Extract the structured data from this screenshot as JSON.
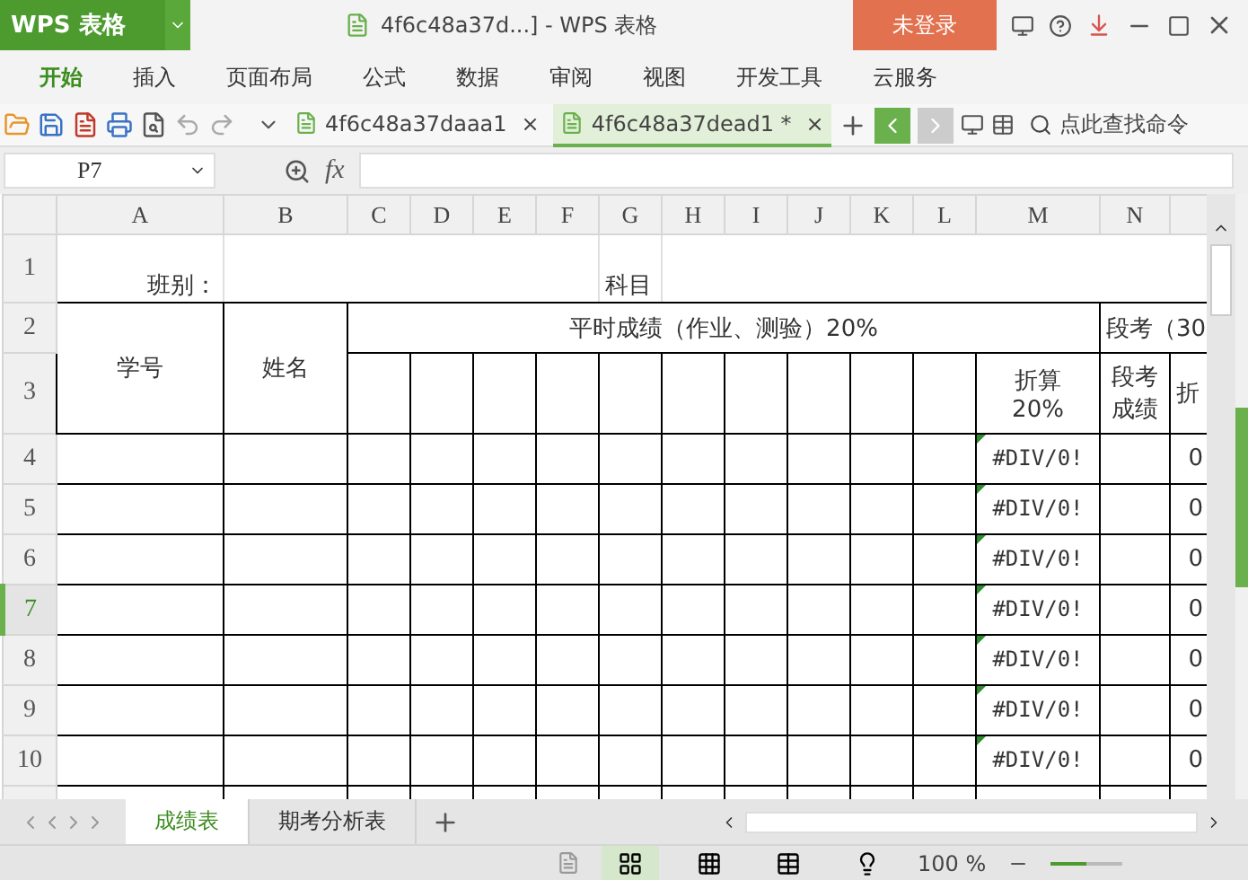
{
  "app": {
    "logo": "WPS 表格",
    "title": "4f6c48a37d...] - WPS 表格",
    "login": "未登录"
  },
  "menu": [
    {
      "label": "开始",
      "selected": true
    },
    {
      "label": "插入",
      "selected": false
    },
    {
      "label": "页面布局",
      "selected": false
    },
    {
      "label": "公式",
      "selected": false
    },
    {
      "label": "数据",
      "selected": false
    },
    {
      "label": "审阅",
      "selected": false
    },
    {
      "label": "视图",
      "selected": false
    },
    {
      "label": "开发工具",
      "selected": false
    },
    {
      "label": "云服务",
      "selected": false
    }
  ],
  "doc_tabs": [
    {
      "label": "4f6c48a37daaa1",
      "close": "×",
      "selected": false
    },
    {
      "label": "4f6c48a37dead1 *",
      "close": "×",
      "selected": true
    }
  ],
  "search": {
    "placeholder": "点此查找命令"
  },
  "formula_bar": {
    "cell": "P7",
    "fx": "fx"
  },
  "sheet": {
    "columns": [
      "A",
      "B",
      "C",
      "D",
      "E",
      "F",
      "G",
      "H",
      "I",
      "J",
      "K",
      "L",
      "M",
      "N"
    ],
    "row_headers": [
      {
        "label": "1",
        "selected": false
      },
      {
        "label": "2",
        "selected": false
      },
      {
        "label": "3",
        "selected": false
      },
      {
        "label": "4",
        "selected": false
      },
      {
        "label": "5",
        "selected": false
      },
      {
        "label": "6",
        "selected": false
      },
      {
        "label": "7",
        "selected": true
      },
      {
        "label": "8",
        "selected": false
      },
      {
        "label": "9",
        "selected": false
      },
      {
        "label": "10",
        "selected": false
      }
    ],
    "class_label": "班别：",
    "subject_label": "科目",
    "student_id": "学号",
    "name": "姓名",
    "regular_scores": "平时成绩（作业、测验）20%",
    "regular_weighted": [
      "折算",
      "20%"
    ],
    "exam": "段考（30",
    "exam_score": [
      "段考",
      "成绩"
    ],
    "exam_weighted": "折",
    "data_rows": [
      {
        "column_m": "#DIV/0!",
        "column_o": "0"
      },
      {
        "column_m": "#DIV/0!",
        "column_o": "0"
      },
      {
        "column_m": "#DIV/0!",
        "column_o": "0"
      },
      {
        "column_m": "#DIV/0!",
        "column_o": "0"
      },
      {
        "column_m": "#DIV/0!",
        "column_o": "0"
      },
      {
        "column_m": "#DIV/0!",
        "column_o": "0"
      },
      {
        "column_m": "#DIV/0!",
        "column_o": "0"
      }
    ]
  },
  "sheet_tabs": [
    {
      "label": "成绩表",
      "selected": true
    },
    {
      "label": "期考分析表",
      "selected": false
    }
  ],
  "status_bar": {
    "zoom": "100 %",
    "zoom_slider": {
      "level": 0.5
    }
  }
}
